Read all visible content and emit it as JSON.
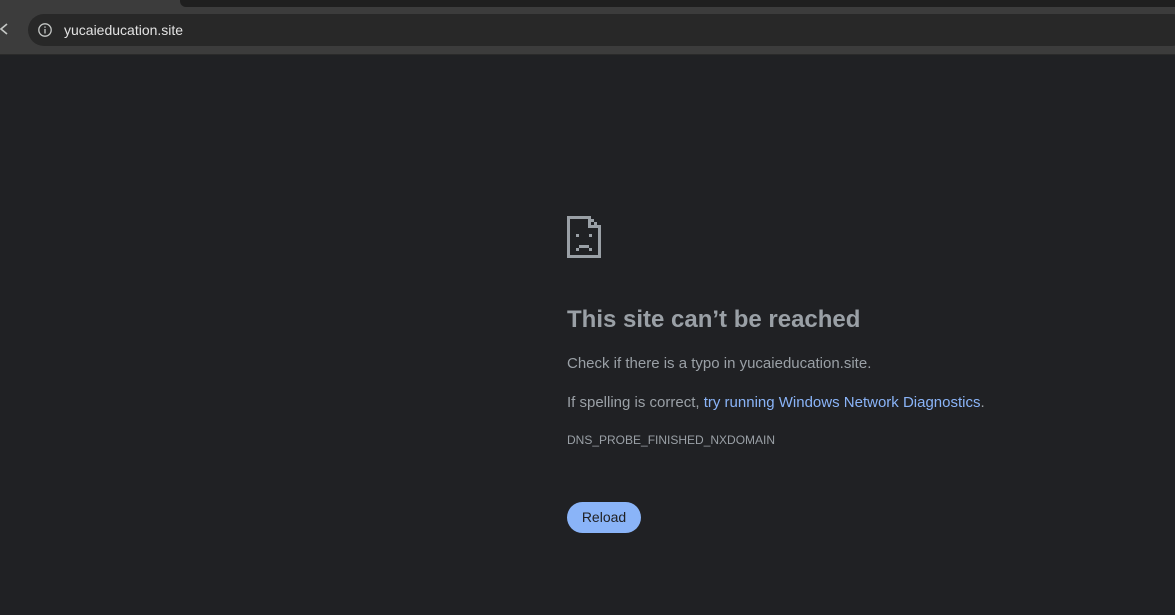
{
  "browser": {
    "url": "yucaieducation.site"
  },
  "error_page": {
    "title": "This site can’t be reached",
    "typo_prefix": "Check if there is a typo in ",
    "typo_domain": "yucaieducation.site",
    "typo_suffix": ".",
    "spelling_prefix": "If spelling is correct, ",
    "diagnostics_link": "try running Windows Network Diagnostics",
    "spelling_suffix": ".",
    "error_code": "DNS_PROBE_FINISHED_NXDOMAIN",
    "reload_label": "Reload"
  },
  "icons": {
    "back": "back-arrow-icon",
    "info": "info-icon",
    "error": "sad-page-icon"
  },
  "colors": {
    "background": "#202124",
    "toolbar": "#3c3c3c",
    "omnibox": "#282828",
    "text": "#9aa0a6",
    "link": "#8ab4f8",
    "button": "#8ab4f8"
  }
}
